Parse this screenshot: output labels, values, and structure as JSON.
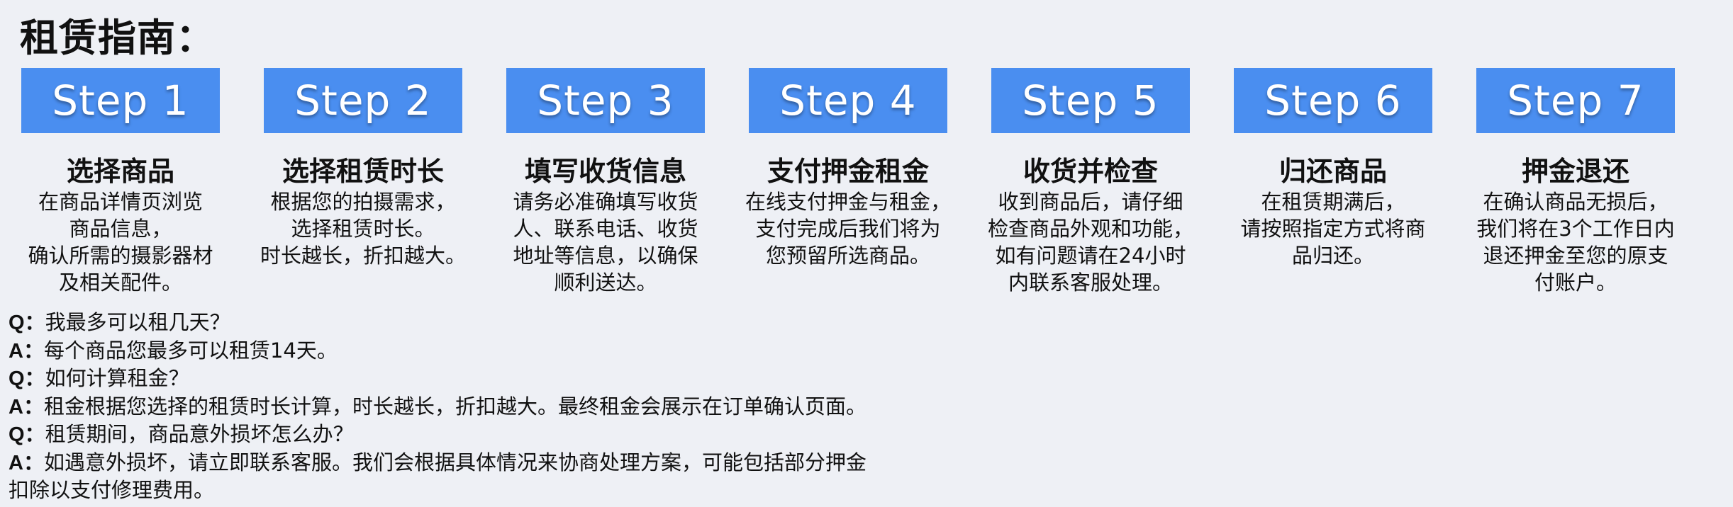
{
  "page": {
    "title": "租赁指南："
  },
  "steps": [
    {
      "badge": "Step 1",
      "heading": "选择商品",
      "lines": [
        "在商品详情页浏览",
        "商品信息，",
        "确认所需的摄影器材",
        "及相关配件。"
      ]
    },
    {
      "badge": "Step 2",
      "heading": "选择租赁时长",
      "lines": [
        "根据您的拍摄需求，",
        "选择租赁时长。",
        "时长越长，折扣越大。"
      ]
    },
    {
      "badge": "Step 3",
      "heading": "填写收货信息",
      "lines": [
        "请务必准确填写收货",
        "人、联系电话、收货",
        "地址等信息，以确保",
        "顺利送达。"
      ]
    },
    {
      "badge": "Step 4",
      "heading": "支付押金租金",
      "lines": [
        "在线支付押金与租金，",
        "支付完成后我们将为",
        "您预留所选商品。"
      ]
    },
    {
      "badge": "Step 5",
      "heading": "收货并检查",
      "lines": [
        "收到商品后，请仔细",
        "检查商品外观和功能，",
        "如有问题请在24小时",
        "内联系客服处理。"
      ]
    },
    {
      "badge": "Step 6",
      "heading": "归还商品",
      "lines": [
        "在租赁期满后，",
        "请按照指定方式将商",
        "品归还。"
      ]
    },
    {
      "badge": "Step 7",
      "heading": "押金退还",
      "lines": [
        "在确认商品无损后，",
        "我们将在3个工作日内",
        "退还押金至您的原支",
        "付账户。"
      ]
    }
  ],
  "faq": {
    "q_label": "Q：",
    "a_label": "A：",
    "items": [
      {
        "question": "我最多可以租几天？",
        "answer": "每个商品您最多可以租赁14天。"
      },
      {
        "question": "如何计算租金？",
        "answer": "租金根据您选择的租赁时长计算，时长越长，折扣越大。最终租金会展示在订单确认页面。"
      },
      {
        "question": "租赁期间，商品意外损坏怎么办？",
        "answer": "如遇意外损坏，请立即联系客服。我们会根据具体情况来协商处理方案，可能包括部分押金",
        "answer_continued": "扣除以支付修理费用。"
      }
    ]
  },
  "colors": {
    "badge_background": "#4a8ef0",
    "page_background": "#eef0f5"
  }
}
